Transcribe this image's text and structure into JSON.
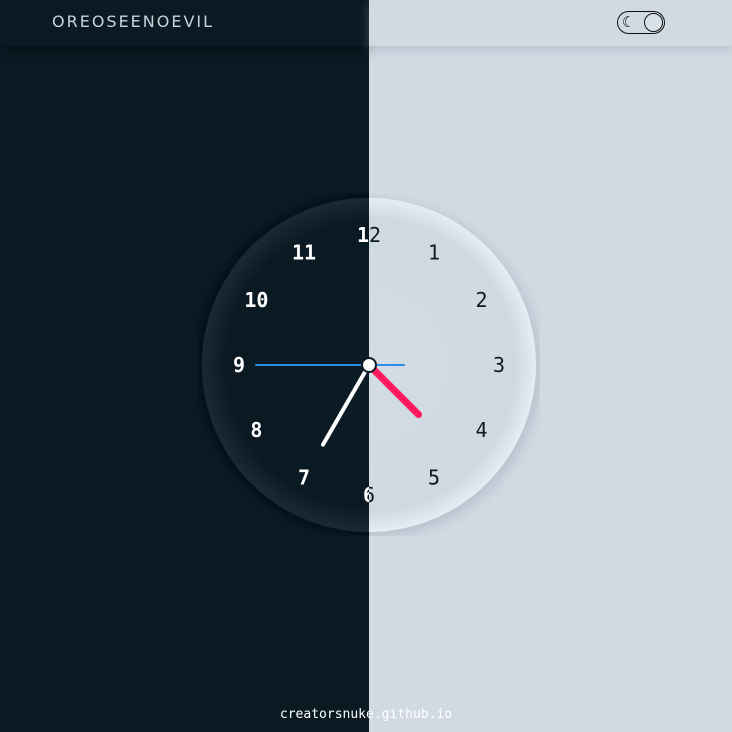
{
  "header": {
    "brand": "OREOSEENOEVIL"
  },
  "theme_toggle": {
    "icon": "moon-icon",
    "state": "dark"
  },
  "clock": {
    "numbers": [
      "12",
      "1",
      "2",
      "3",
      "4",
      "5",
      "6",
      "7",
      "8",
      "9",
      "10",
      "11"
    ],
    "hour_hand_value": 4.5,
    "minute_hand_value": 35,
    "second_hand_value": 45,
    "colors": {
      "hour_hand": "#ff1a5e",
      "minute_hand": "#ffffff",
      "second_hand": "#2b8fe8",
      "dark_bg": "#0a1a23",
      "light_bg": "#d1dae3"
    }
  },
  "footer": {
    "credit": "creatorsnuke.github.io"
  }
}
